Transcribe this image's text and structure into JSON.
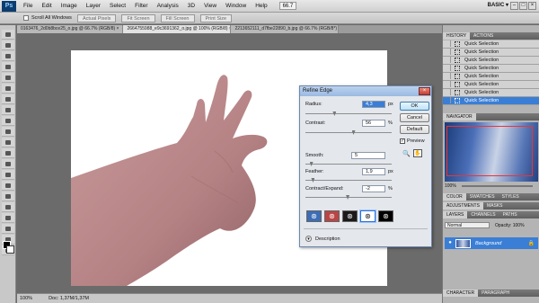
{
  "app": {
    "logo": "Ps",
    "menu": [
      "File",
      "Edit",
      "Image",
      "Layer",
      "Select",
      "Filter",
      "Analysis",
      "3D",
      "View",
      "Window",
      "Help"
    ],
    "zoom": "66.7",
    "workspace": "BASIC ▾",
    "window_controls": [
      "–",
      "□",
      "×"
    ]
  },
  "options_bar": {
    "scroll_all_label": "Scroll All Windows",
    "buttons": [
      "Actual Pixels",
      "Fit Screen",
      "Fill Screen",
      "Print Size"
    ]
  },
  "tabs": [
    {
      "label": "0163476_2d0b8bce25_o.jpg @ 66.7% (RGB/8) ×",
      "active": false
    },
    {
      "label": "2664755988_e9c3691362_o.jpg @ 100% (RGB/8) ×",
      "active": true
    },
    {
      "label": "2213652111_d7fbe22890_b.jpg @ 66.7% (RGB/8*) ×",
      "active": false
    }
  ],
  "status": {
    "zoom": "100%",
    "doc": "Doc: 1,37M/1,37M"
  },
  "panels": {
    "history_tabs": [
      "HISTORY",
      "ACTIONS"
    ],
    "history_items": [
      {
        "label": "Quick Selection",
        "selected": false
      },
      {
        "label": "Quick Selection",
        "selected": false
      },
      {
        "label": "Quick Selection",
        "selected": false
      },
      {
        "label": "Quick Selection",
        "selected": false
      },
      {
        "label": "Quick Selection",
        "selected": false
      },
      {
        "label": "Quick Selection",
        "selected": false
      },
      {
        "label": "Quick Selection",
        "selected": false
      },
      {
        "label": "Quick Selection",
        "selected": true
      }
    ],
    "navigator_tab": "NAVIGATOR",
    "nav_zoom": "100%",
    "color_tabs": [
      "COLOR",
      "SWATCHES",
      "STYLES"
    ],
    "adjust_tabs": [
      "ADJUSTMENTS",
      "MASKS"
    ],
    "layers_tabs": [
      "LAYERS",
      "CHANNELS",
      "PATHS"
    ],
    "blend_mode": "Normal",
    "opacity_label": "Opacity: 100%",
    "layer_name": "Background",
    "char_tabs": [
      "CHARACTER",
      "PARAGRAPH"
    ]
  },
  "dialog": {
    "title": "Refine Edge",
    "close": "×",
    "radius_label": "Radius:",
    "radius_value": "4,3",
    "radius_unit": "px",
    "contrast_label": "Contrast:",
    "contrast_value": "56",
    "contrast_unit": "%",
    "smooth_label": "Smooth:",
    "smooth_value": "5",
    "feather_label": "Feather:",
    "feather_value": "1,9",
    "feather_unit": "px",
    "contract_label": "Contract/Expand:",
    "contract_value": "-2",
    "contract_unit": "%",
    "ok_label": "OK",
    "cancel_label": "Cancel",
    "default_label": "Default",
    "preview_label": "Preview",
    "preview_checked": "✓",
    "description_label": "Description",
    "slider_levels": {
      "radius": 0.33,
      "contrast": 0.56,
      "smooth": 0.05,
      "feather": 0.07,
      "contract": 0.49
    },
    "view_modes": [
      {
        "icon": "standard-view-icon",
        "bg": "#3d6db5"
      },
      {
        "icon": "quick-mask-view-icon",
        "bg": "#b94545"
      },
      {
        "icon": "on-black-view-icon",
        "bg": "#1a1a1a"
      },
      {
        "icon": "on-white-view-icon",
        "bg": "#ffffff"
      },
      {
        "icon": "mask-view-icon",
        "bg": "#000000"
      }
    ]
  },
  "colors": {
    "accent": "#3a7ed6",
    "skin": "#b9878a"
  }
}
